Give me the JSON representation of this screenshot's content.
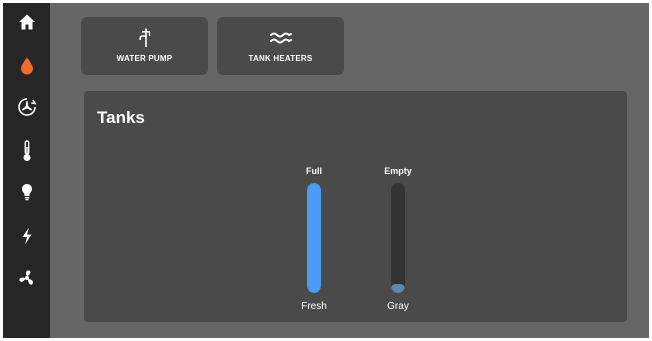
{
  "sidebar": {
    "items": [
      {
        "icon": "home-icon",
        "color": "#ffffff"
      },
      {
        "icon": "water-drop-icon",
        "color": "#f26b2c",
        "active": true
      },
      {
        "icon": "fan-speed-icon",
        "color": "#ffffff"
      },
      {
        "icon": "thermometer-icon",
        "color": "#ffffff"
      },
      {
        "icon": "light-bulb-icon",
        "color": "#ffffff"
      },
      {
        "icon": "lightning-bolt-icon",
        "color": "#ffffff"
      },
      {
        "icon": "ventilation-fan-icon",
        "color": "#ffffff"
      }
    ]
  },
  "controls": {
    "water_pump": {
      "label": "WATER PUMP",
      "icon": "faucet-icon"
    },
    "tank_heaters": {
      "label": "TANK HEATERS",
      "icon": "heat-waves-icon"
    }
  },
  "tanks": {
    "title": "Tanks",
    "items": [
      {
        "name": "Fresh",
        "level_label": "Full",
        "level_fraction": 1.0,
        "color": "#4a9cf5"
      },
      {
        "name": "Gray",
        "level_label": "Empty",
        "level_fraction": 0.08,
        "color": "#5f86ad"
      }
    ]
  },
  "colors": {
    "accent": "#f26b2c",
    "fresh_water": "#4a9cf5",
    "gray_water": "#5f86ad"
  }
}
